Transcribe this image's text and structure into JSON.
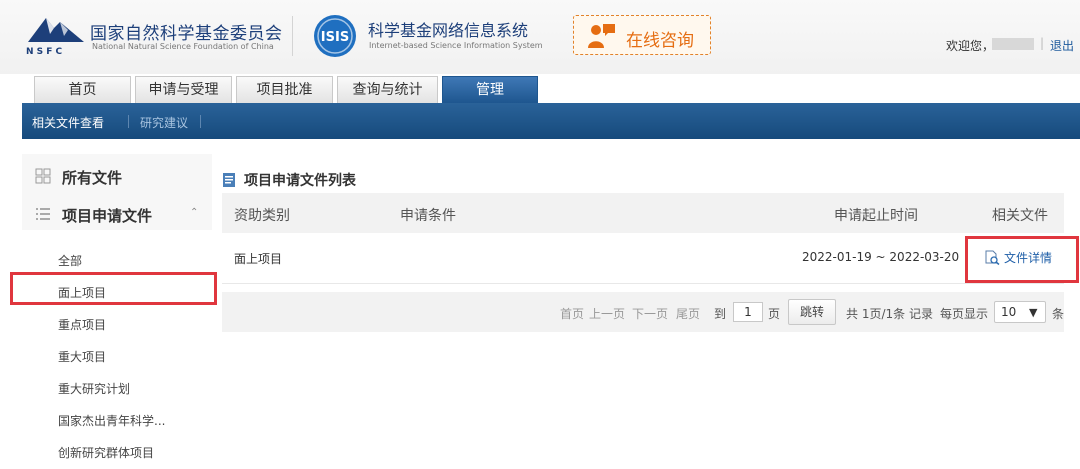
{
  "header": {
    "org_cn": "国家自然科学基金委员会",
    "org_en": "National Natural Science Foundation of China",
    "logo_letters": "N S F C",
    "system_cn": "科学基金网络信息系统",
    "system_en": "Internet-based Science Information System",
    "isis_logo": "ISIS",
    "consult_label": "在线咨询",
    "welcome": "欢迎您，",
    "separator": "|",
    "logout": "退出"
  },
  "tabs": [
    {
      "label": "首页",
      "active": false
    },
    {
      "label": "申请与受理",
      "active": false
    },
    {
      "label": "项目批准",
      "active": false
    },
    {
      "label": "查询与统计",
      "active": false
    },
    {
      "label": "管理",
      "active": true
    }
  ],
  "subnav": [
    {
      "label": "相关文件查看",
      "active": true
    },
    {
      "label": "研究建议",
      "active": false
    }
  ],
  "sidebar": {
    "all_files": "所有文件",
    "project_files": "项目申请文件",
    "items": [
      "全部",
      "面上项目",
      "重点项目",
      "重大项目",
      "重大研究计划",
      "国家杰出青年科学...",
      "创新研究群体项目"
    ]
  },
  "main": {
    "title": "项目申请文件列表",
    "columns": [
      "资助类别",
      "申请条件",
      "申请起止时间",
      "相关文件"
    ],
    "rows": [
      {
        "category": "面上项目",
        "condition": "",
        "period": "2022-01-19 ~ 2022-03-20",
        "file_link": "文件详情"
      }
    ]
  },
  "pager": {
    "first": "首页",
    "prev": "上一页",
    "next": "下一页",
    "last": "尾页",
    "to": "到",
    "page_value": "1",
    "page_unit": "页",
    "jump": "跳转",
    "summary": "共 1页/1条 记录",
    "per_page_label": "每页显示",
    "per_page_value": "10",
    "per_page_unit": "条"
  },
  "colors": {
    "brand_blue": "#1d3f7a",
    "nav_blue": "#1e568f",
    "highlight_red": "#e0363e",
    "consult_orange": "#e56d12"
  }
}
